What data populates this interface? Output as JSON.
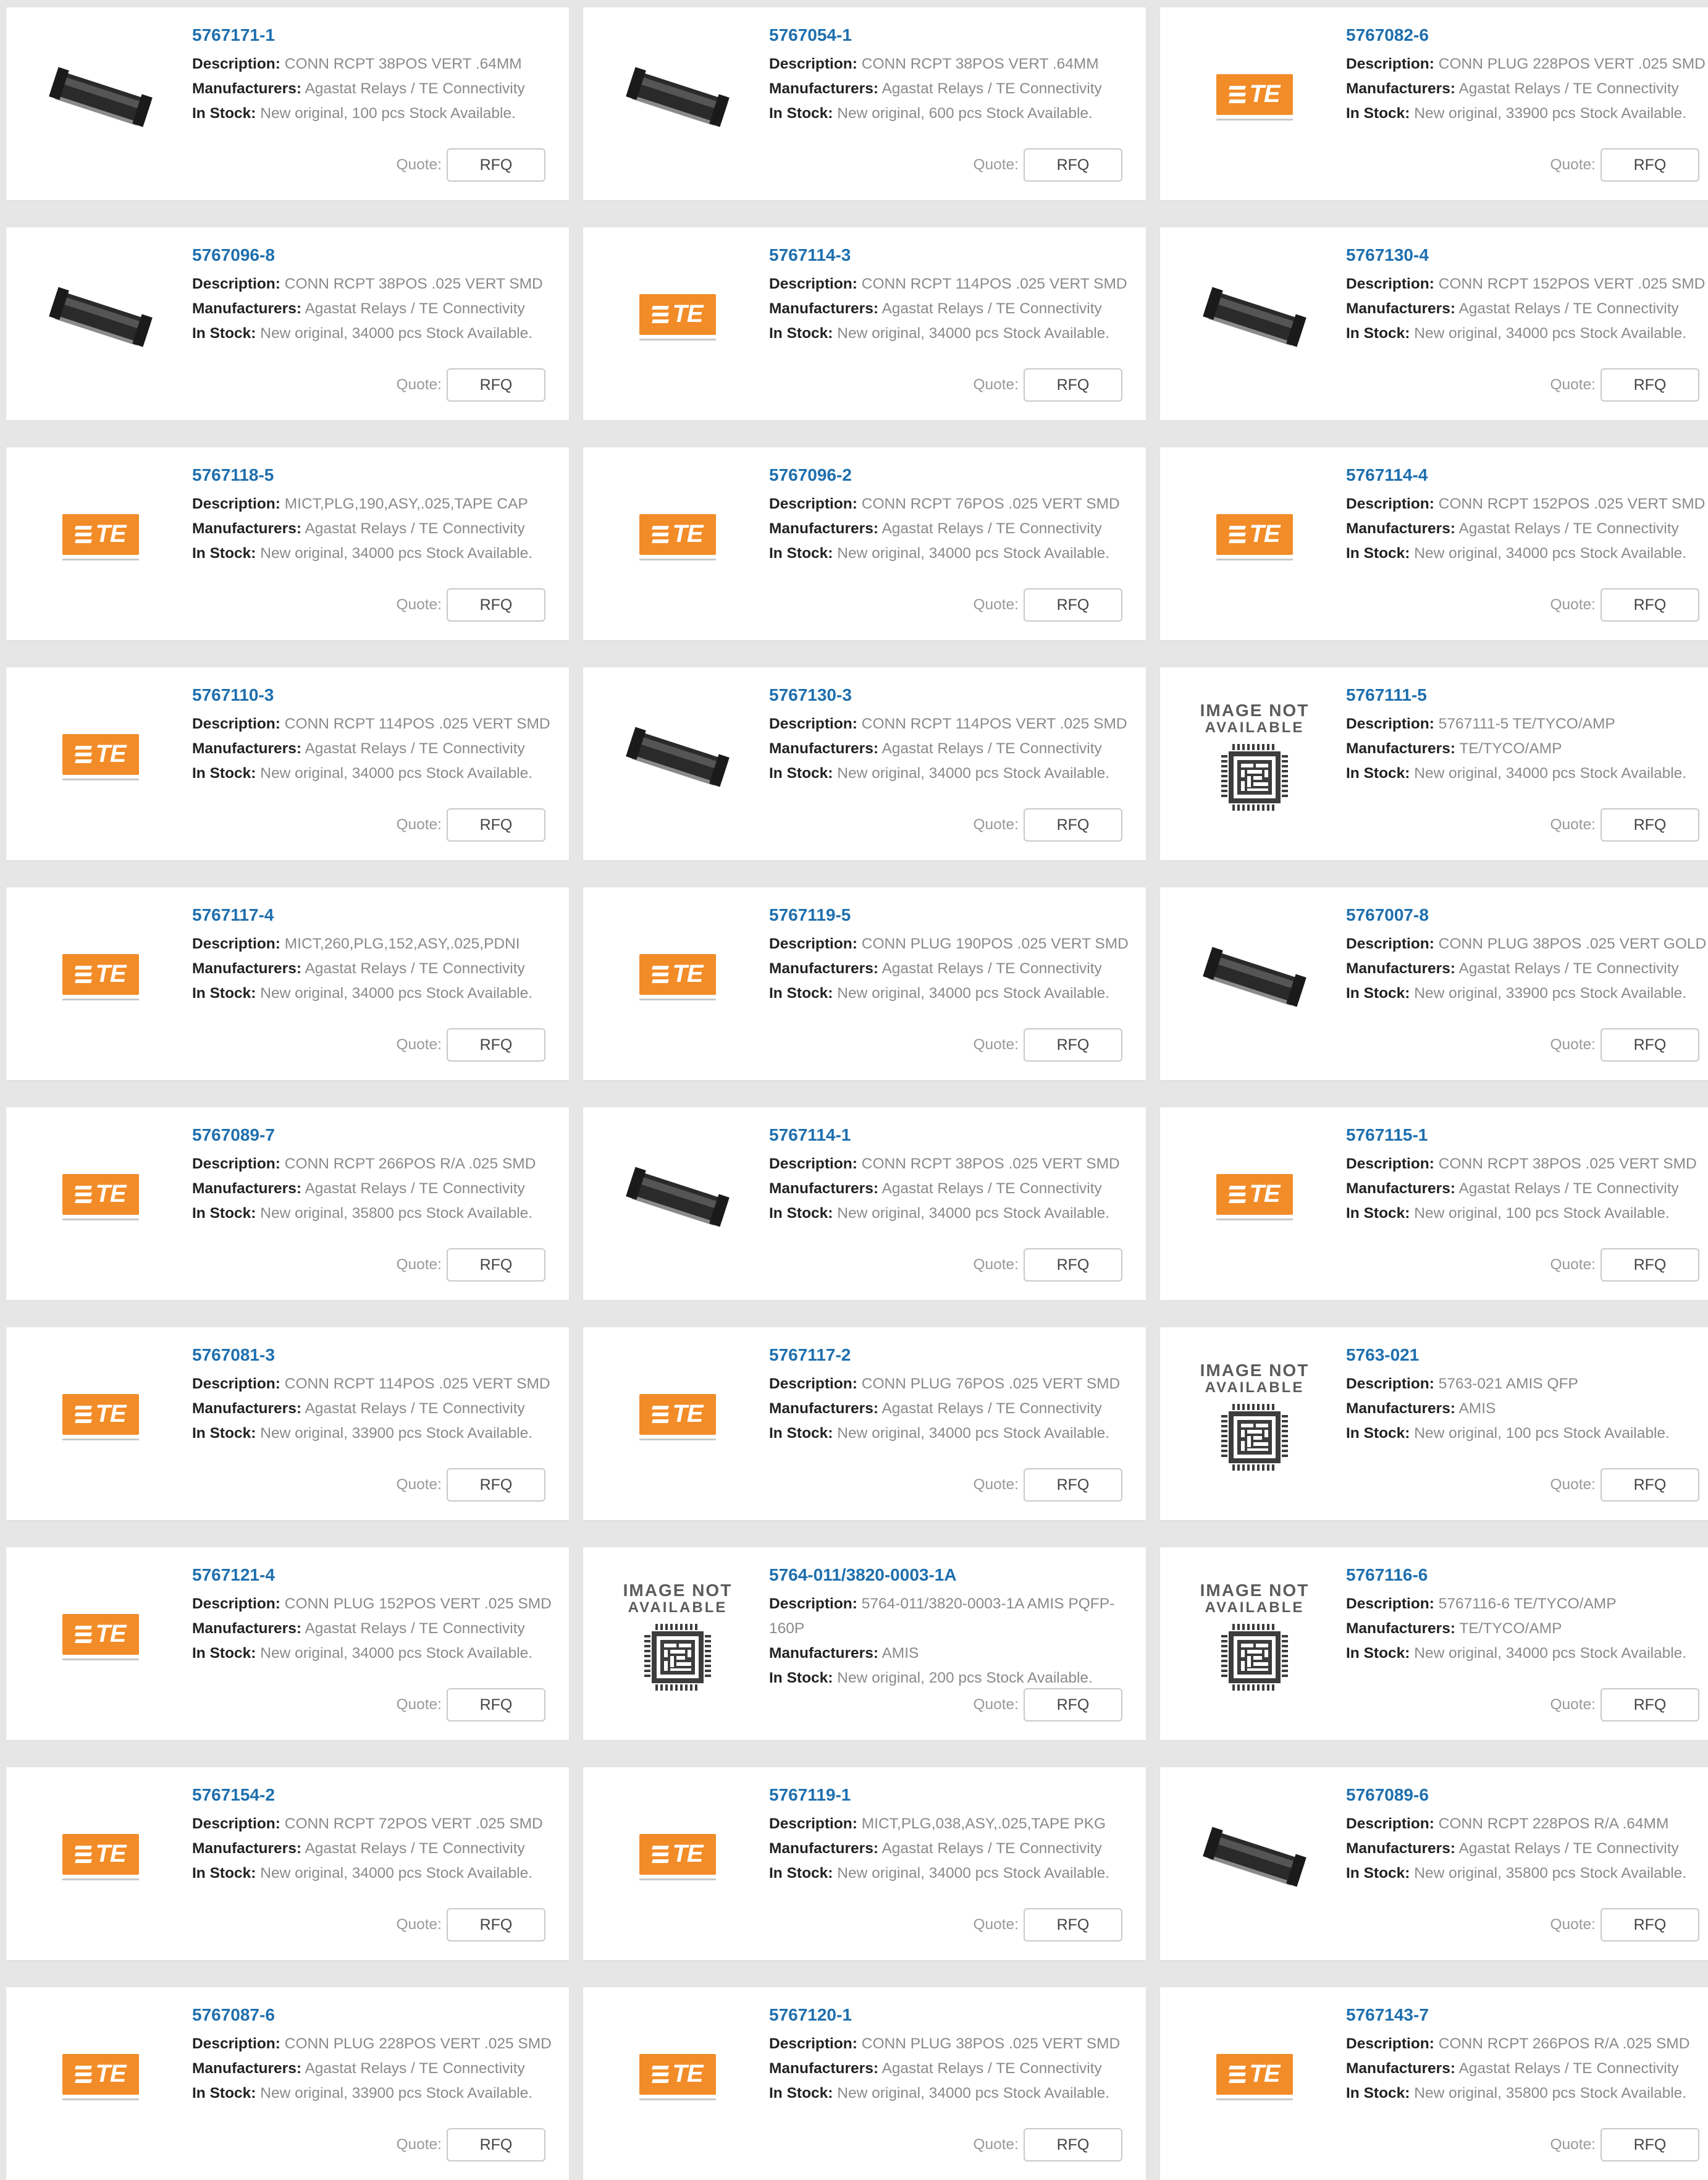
{
  "labels": {
    "description": "Description:",
    "manufacturers": "Manufacturers:",
    "in_stock": "In Stock:",
    "quote": "Quote:",
    "rfq": "RFQ",
    "image_not_available_line1": "IMAGE NOT",
    "image_not_available_line2": "AVAILABLE",
    "te_logo_text": "TE"
  },
  "colors": {
    "link": "#1e6fae",
    "te_orange": "#f28c28",
    "page_background": "#e6e6e6"
  },
  "products": [
    {
      "part": "5767171-1",
      "description": "CONN RCPT 38POS VERT .64MM",
      "manufacturer": "Agastat Relays / TE Connectivity",
      "stock": "New original, 100 pcs Stock Available.",
      "image": "connector-photo"
    },
    {
      "part": "5767054-1",
      "description": "CONN RCPT 38POS VERT .64MM",
      "manufacturer": "Agastat Relays / TE Connectivity",
      "stock": "New original, 600 pcs Stock Available.",
      "image": "connector-photo"
    },
    {
      "part": "5767082-6",
      "description": "CONN PLUG 228POS VERT .025 SMD",
      "manufacturer": "Agastat Relays / TE Connectivity",
      "stock": "New original, 33900 pcs Stock Available.",
      "image": "te-logo"
    },
    {
      "part": "5767096-8",
      "description": "CONN RCPT 38POS .025 VERT SMD",
      "manufacturer": "Agastat Relays / TE Connectivity",
      "stock": "New original, 34000 pcs Stock Available.",
      "image": "connector-photo"
    },
    {
      "part": "5767114-3",
      "description": "CONN RCPT 114POS .025 VERT SMD",
      "manufacturer": "Agastat Relays / TE Connectivity",
      "stock": "New original, 34000 pcs Stock Available.",
      "image": "te-logo"
    },
    {
      "part": "5767130-4",
      "description": "CONN RCPT 152POS VERT .025 SMD",
      "manufacturer": "Agastat Relays / TE Connectivity",
      "stock": "New original, 34000 pcs Stock Available.",
      "image": "connector-photo"
    },
    {
      "part": "5767118-5",
      "description": "MICT,PLG,190,ASY,.025,TAPE CAP",
      "manufacturer": "Agastat Relays / TE Connectivity",
      "stock": "New original, 34000 pcs Stock Available.",
      "image": "te-logo"
    },
    {
      "part": "5767096-2",
      "description": "CONN RCPT 76POS .025 VERT SMD",
      "manufacturer": "Agastat Relays / TE Connectivity",
      "stock": "New original, 34000 pcs Stock Available.",
      "image": "te-logo"
    },
    {
      "part": "5767114-4",
      "description": "CONN RCPT 152POS .025 VERT SMD",
      "manufacturer": "Agastat Relays / TE Connectivity",
      "stock": "New original, 34000 pcs Stock Available.",
      "image": "te-logo"
    },
    {
      "part": "5767110-3",
      "description": "CONN RCPT 114POS .025 VERT SMD",
      "manufacturer": "Agastat Relays / TE Connectivity",
      "stock": "New original, 34000 pcs Stock Available.",
      "image": "te-logo"
    },
    {
      "part": "5767130-3",
      "description": "CONN RCPT 114POS VERT .025 SMD",
      "manufacturer": "Agastat Relays / TE Connectivity",
      "stock": "New original, 34000 pcs Stock Available.",
      "image": "connector-photo"
    },
    {
      "part": "5767111-5",
      "description": "5767111-5 TE/TYCO/AMP",
      "manufacturer": "TE/TYCO/AMP",
      "stock": "New original, 34000 pcs Stock Available.",
      "image": "image-not-available"
    },
    {
      "part": "5767117-4",
      "description": "MICT,260,PLG,152,ASY,.025,PDNI",
      "manufacturer": "Agastat Relays / TE Connectivity",
      "stock": "New original, 34000 pcs Stock Available.",
      "image": "te-logo"
    },
    {
      "part": "5767119-5",
      "description": "CONN PLUG 190POS .025 VERT SMD",
      "manufacturer": "Agastat Relays / TE Connectivity",
      "stock": "New original, 34000 pcs Stock Available.",
      "image": "te-logo"
    },
    {
      "part": "5767007-8",
      "description": "CONN PLUG 38POS .025 VERT GOLD",
      "manufacturer": "Agastat Relays / TE Connectivity",
      "stock": "New original, 33900 pcs Stock Available.",
      "image": "connector-photo"
    },
    {
      "part": "5767089-7",
      "description": "CONN RCPT 266POS R/A .025 SMD",
      "manufacturer": "Agastat Relays / TE Connectivity",
      "stock": "New original, 35800 pcs Stock Available.",
      "image": "te-logo"
    },
    {
      "part": "5767114-1",
      "description": "CONN RCPT 38POS .025 VERT SMD",
      "manufacturer": "Agastat Relays / TE Connectivity",
      "stock": "New original, 34000 pcs Stock Available.",
      "image": "connector-photo"
    },
    {
      "part": "5767115-1",
      "description": "CONN RCPT 38POS .025 VERT SMD",
      "manufacturer": "Agastat Relays / TE Connectivity",
      "stock": "New original, 100 pcs Stock Available.",
      "image": "te-logo"
    },
    {
      "part": "5767081-3",
      "description": "CONN RCPT 114POS .025 VERT SMD",
      "manufacturer": "Agastat Relays / TE Connectivity",
      "stock": "New original, 33900 pcs Stock Available.",
      "image": "te-logo"
    },
    {
      "part": "5767117-2",
      "description": "CONN PLUG 76POS .025 VERT SMD",
      "manufacturer": "Agastat Relays / TE Connectivity",
      "stock": "New original, 34000 pcs Stock Available.",
      "image": "te-logo"
    },
    {
      "part": "5763-021",
      "description": "5763-021 AMIS QFP",
      "manufacturer": "AMIS",
      "stock": "New original, 100 pcs Stock Available.",
      "image": "image-not-available"
    },
    {
      "part": "5767121-4",
      "description": "CONN PLUG 152POS VERT .025 SMD",
      "manufacturer": "Agastat Relays / TE Connectivity",
      "stock": "New original, 34000 pcs Stock Available.",
      "image": "te-logo"
    },
    {
      "part": "5764-011/3820-0003-1A",
      "description": "5764-011/3820-0003-1A AMIS PQFP-160P",
      "manufacturer": "AMIS",
      "stock": "New original, 200 pcs Stock Available.",
      "image": "image-not-available",
      "wrap": true
    },
    {
      "part": "5767116-6",
      "description": "5767116-6 TE/TYCO/AMP",
      "manufacturer": "TE/TYCO/AMP",
      "stock": "New original, 34000 pcs Stock Available.",
      "image": "image-not-available"
    },
    {
      "part": "5767154-2",
      "description": "CONN RCPT 72POS VERT .025 SMD",
      "manufacturer": "Agastat Relays / TE Connectivity",
      "stock": "New original, 34000 pcs Stock Available.",
      "image": "te-logo"
    },
    {
      "part": "5767119-1",
      "description": "MICT,PLG,038,ASY,.025,TAPE PKG",
      "manufacturer": "Agastat Relays / TE Connectivity",
      "stock": "New original, 34000 pcs Stock Available.",
      "image": "te-logo"
    },
    {
      "part": "5767089-6",
      "description": "CONN RCPT 228POS R/A .64MM",
      "manufacturer": "Agastat Relays / TE Connectivity",
      "stock": "New original, 35800 pcs Stock Available.",
      "image": "connector-photo"
    },
    {
      "part": "5767087-6",
      "description": "CONN PLUG 228POS VERT .025 SMD",
      "manufacturer": "Agastat Relays / TE Connectivity",
      "stock": "New original, 33900 pcs Stock Available.",
      "image": "te-logo"
    },
    {
      "part": "5767120-1",
      "description": "CONN PLUG 38POS .025 VERT SMD",
      "manufacturer": "Agastat Relays / TE Connectivity",
      "stock": "New original, 34000 pcs Stock Available.",
      "image": "te-logo"
    },
    {
      "part": "5767143-7",
      "description": "CONN RCPT 266POS R/A .025 SMD",
      "manufacturer": "Agastat Relays / TE Connectivity",
      "stock": "New original, 35800 pcs Stock Available.",
      "image": "te-logo"
    }
  ]
}
